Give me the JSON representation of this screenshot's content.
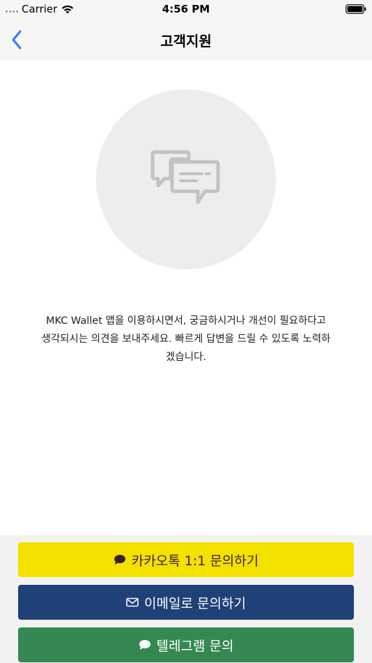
{
  "status_bar": {
    "carrier": "Carrier",
    "time": "4:56 PM"
  },
  "navbar": {
    "title": "고객지원",
    "back_icon": "chevron-left-icon"
  },
  "illustration": {
    "icon": "chat-bubbles-icon"
  },
  "description": "MKC Wallet 앱을 이용하시면서, 궁금하시거나 개선이 필요하다고\n생각되시는 의견을 보내주세요. 빠르게 답변을 드릴 수 있도록 노력하\n겠습니다.",
  "buttons": {
    "kakao": {
      "label": "카카오톡 1:1 문의하기",
      "icon": "speech-bubble-icon",
      "color": "#f4e100"
    },
    "email": {
      "label": "이메일로 문의하기",
      "icon": "envelope-icon",
      "color": "#1f4178"
    },
    "telegram": {
      "label": "텔레그램 문의",
      "icon": "speech-bubble-icon",
      "color": "#358852"
    }
  },
  "colors": {
    "accent": "#2f7bf5",
    "navbar_bg": "#f6f6f6"
  }
}
